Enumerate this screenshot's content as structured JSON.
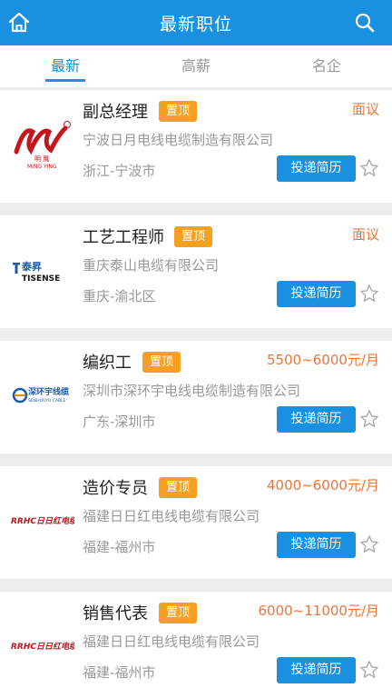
{
  "header": {
    "title": "最新职位",
    "home_icon": "home-icon",
    "search_icon": "search-icon",
    "bg_color": "#1a90e0"
  },
  "tabs": [
    {
      "label": "最新",
      "active": true
    },
    {
      "label": "高薪",
      "active": false
    },
    {
      "label": "名企",
      "active": false
    }
  ],
  "jobs": [
    {
      "title": "副总经理",
      "badge": "置顶",
      "salary": "面议",
      "company": "宁波日月电线电缆制造有限公司",
      "location": "浙江-宁波市",
      "apply_label": "投递简历",
      "logo_text": "明 鹰",
      "logo_sub": "MING YING"
    },
    {
      "title": "工艺工程师",
      "badge": "置顶",
      "salary": "面议",
      "company": "重庆泰山电缆有限公司",
      "location": "重庆-渝北区",
      "apply_label": "投递简历",
      "logo_text": "泰昇",
      "logo_sub": "TISENSE"
    },
    {
      "title": "编织工",
      "badge": "置顶",
      "salary": "5500~6000元/月",
      "company": "深圳市深环宇电线电缆制造有限公司",
      "location": "广东-深圳市",
      "apply_label": "投递简历",
      "logo_text": "深环宇线缆",
      "logo_sub": "SENHOUYU CABLE"
    },
    {
      "title": "造价专员",
      "badge": "置顶",
      "salary": "4000~6000元/月",
      "company": "福建日日红电线电缆有限公司",
      "location": "福建-福州市",
      "apply_label": "投递简历",
      "logo_text": "RRHC日日红电缆",
      "logo_sub": ""
    },
    {
      "title": "销售代表",
      "badge": "置顶",
      "salary": "6000~11000元/月",
      "company": "福建日日红电线电缆有限公司",
      "location": "福建-福州市",
      "apply_label": "投递简历",
      "logo_text": "RRHC日日红电缆",
      "logo_sub": ""
    }
  ]
}
